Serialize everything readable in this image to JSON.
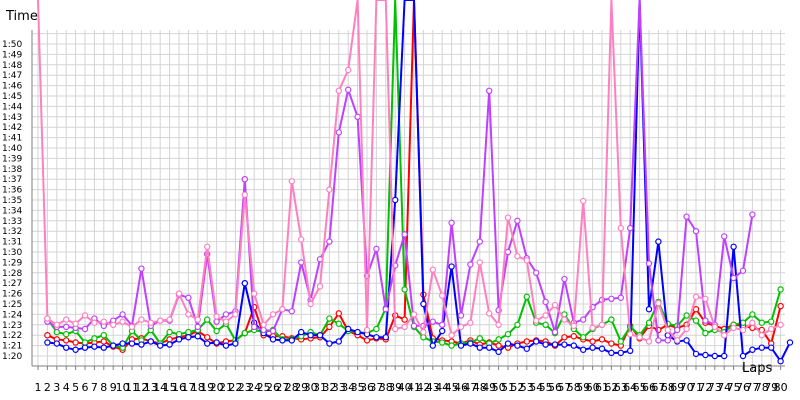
{
  "chart_data": {
    "type": "line",
    "title": "",
    "xlabel": "Laps",
    "ylabel": "Time",
    "xlim": [
      1,
      80
    ],
    "ylim": [
      "1:19",
      "1:51"
    ],
    "grid": true,
    "legend": "none",
    "y_ticks": [
      "1:20",
      "1:21",
      "1:22",
      "1:23",
      "1:24",
      "1:25",
      "1:26",
      "1:27",
      "1:28",
      "1:29",
      "1:30",
      "1:31",
      "1:32",
      "1:33",
      "1:34",
      "1:35",
      "1:36",
      "1:37",
      "1:38",
      "1:39",
      "1:40",
      "1:41",
      "1:42",
      "1:43",
      "1:44",
      "1:45",
      "1:46",
      "1:47",
      "1:48",
      "1:49",
      "1:50"
    ],
    "x_ticks": [
      1,
      2,
      3,
      4,
      5,
      6,
      7,
      8,
      9,
      10,
      11,
      12,
      13,
      14,
      15,
      16,
      17,
      18,
      19,
      20,
      21,
      22,
      23,
      24,
      25,
      26,
      27,
      28,
      29,
      30,
      31,
      32,
      33,
      34,
      35,
      36,
      37,
      38,
      39,
      40,
      41,
      42,
      43,
      44,
      45,
      46,
      47,
      48,
      49,
      50,
      51,
      52,
      53,
      54,
      55,
      56,
      57,
      58,
      59,
      60,
      61,
      62,
      63,
      64,
      65,
      66,
      67,
      68,
      69,
      70,
      71,
      72,
      73,
      74,
      75,
      76,
      77,
      78,
      79,
      80
    ],
    "series": [
      {
        "color": "#ff0000",
        "values": [
          null,
          "1:22.0",
          "1:21.6",
          "1:21.5",
          "1:21.3",
          "1:21.2",
          "1:21.3",
          "1:21.4",
          "1:20.9",
          "1:20.6",
          "1:21.6",
          "1:21.7",
          "1:21.4",
          "1:21.2",
          "1:21.6",
          "1:21.8",
          "1:22.0",
          "1:22.4",
          "1:21.8",
          "1:21.2",
          "1:21.4",
          "1:21.5",
          "1:22.2",
          "1:24.7",
          "1:22.0",
          "1:21.9",
          "1:21.9",
          "1:21.7",
          "1:21.6",
          "1:21.7",
          "1:21.8",
          "1:22.8",
          "1:24.1",
          "1:22.4",
          "1:22.0",
          "1:21.5",
          "1:21.7",
          "1:21.6",
          "1:23.9",
          "1:23.5",
          "2:30.0",
          "1:25.9",
          "1:21.7",
          "1:21.5",
          "1:21.4",
          "1:21.2",
          "1:21.5",
          "1:21.1",
          "1:21.3",
          "1:21.0",
          "1:20.8",
          "1:21.2",
          "1:21.4",
          "1:21.5",
          "1:21.4",
          "1:21.0",
          "1:21.8",
          "1:21.9",
          "1:21.6",
          "1:21.4",
          "1:21.6",
          "1:21.2",
          "1:21.0",
          "1:22.9",
          "1:21.7",
          "1:22.9",
          "1:22.5",
          "1:23.0",
          "1:22.7",
          "1:23.0",
          "1:24.5",
          "1:23.2",
          "1:22.9",
          "1:22.6",
          "1:23.0",
          "1:22.9",
          "1:22.7",
          "1:22.5",
          "1:21.2",
          "1:24.8"
        ]
      },
      {
        "color": "#00c000",
        "values": [
          null,
          "1:23.6",
          "1:22.3",
          "1:22.1",
          "1:22.4",
          "1:21.3",
          "1:21.7",
          "1:22.0",
          "1:21.0",
          "1:20.8",
          "1:22.4",
          "1:21.5",
          "1:22.5",
          "1:21.2",
          "1:22.3",
          "1:22.1",
          "1:22.3",
          "1:22.5",
          "1:23.5",
          "1:22.4",
          "1:23.1",
          "1:21.5",
          "1:22.2",
          "1:22.5",
          "1:22.3",
          "1:22.5",
          "1:21.6",
          "1:21.6",
          "1:21.9",
          "1:22.3",
          "1:22.0",
          "1:23.6",
          "1:23.1",
          "1:22.4",
          "1:22.3",
          "1:22.2",
          "1:22.6",
          "1:24.6",
          "2:30.0",
          "1:26.4",
          "1:22.8",
          "1:21.8",
          "1:21.4",
          "1:21.3",
          "1:21.0",
          "1:21.2",
          "1:21.3",
          "1:21.7",
          "1:21.2",
          "1:21.6",
          "1:22.1",
          "1:23.0",
          "1:25.7",
          "1:23.2",
          "1:23.0",
          "1:22.2",
          "1:24.0",
          "1:22.6",
          "1:21.8",
          "1:22.6",
          "1:23.0",
          "1:23.5",
          "1:21.4",
          "1:22.8",
          "1:22.0",
          "1:23.2",
          "1:25.2",
          "1:23.1",
          "1:22.9",
          "1:23.9",
          "1:23.4",
          "1:22.2",
          "1:22.5",
          "1:22.3",
          "1:23.0",
          "1:23.2",
          "1:24.0",
          "1:23.2",
          "1:23.3",
          "1:26.4"
        ]
      },
      {
        "color": "#0000ff",
        "values": [
          null,
          "1:21.3",
          "1:21.2",
          "1:20.8",
          "1:20.6",
          "1:20.8",
          "1:20.9",
          "1:20.8",
          "1:21.0",
          "1:21.2",
          "1:21.2",
          "1:21.1",
          "1:21.4",
          "1:21.0",
          "1:21.1",
          "1:21.6",
          "1:21.8",
          "1:21.9",
          "1:21.2",
          "1:21.3",
          "1:21.0",
          "1:21.2",
          "1:27.0",
          "1:23.2",
          "1:22.2",
          "1:21.6",
          "1:21.5",
          "1:21.5",
          "1:22.3",
          "1:22.0",
          "1:22.0",
          "1:21.2",
          "1:21.4",
          "1:22.6",
          "1:22.3",
          "1:22.1",
          "1:21.8",
          "1:21.8",
          "1:35.0",
          "2:30.0",
          "2:30.0",
          "1:25.0",
          "1:21.0",
          "1:22.4",
          "1:28.6",
          "1:21.0",
          "1:21.2",
          "1:20.8",
          "1:20.8",
          "1:20.4",
          "1:21.2",
          "1:21.0",
          "1:20.7",
          "1:21.4",
          "1:21.1",
          "1:21.1",
          "1:21.1",
          "1:21.0",
          "1:20.6",
          "1:20.8",
          "1:20.7",
          "1:20.3",
          "1:20.3",
          "1:20.5",
          "2:30.0",
          "1:24.5",
          "1:31.0",
          "1:22.0",
          "1:21.4",
          "1:21.5",
          "1:20.2",
          "1:20.1",
          "1:20.0",
          "1:20.0",
          "1:30.5",
          "1:20.0",
          "1:20.6",
          "1:20.8",
          "1:20.8",
          "1:19.5",
          "1:21.3"
        ]
      },
      {
        "color": "#c040ff",
        "values": [
          null,
          "1:23.3",
          "1:22.8",
          "1:22.8",
          "1:22.7",
          "1:22.6",
          "1:23.6",
          "1:22.9",
          "1:23.4",
          "1:24.0",
          "1:22.9",
          "1:28.4",
          "1:22.9",
          "1:23.4",
          "1:23.4",
          "1:25.9",
          "1:25.6",
          "1:22.8",
          "1:29.8",
          "1:23.3",
          "1:24.0",
          "1:24.3",
          "1:37.0",
          "1:22.8",
          "1:22.5",
          "1:22.4",
          "1:24.5",
          "1:24.3",
          "1:29.0",
          "1:25.4",
          "1:29.3",
          "1:31.0",
          "1:41.5",
          "1:45.6",
          "1:43.0",
          "1:27.7",
          "1:30.3",
          "1:24.5",
          "1:28.7",
          "1:31.7",
          "1:22.9",
          "1:22.9",
          "1:23.3",
          "1:23.0",
          "1:32.8",
          "1:23.9",
          "1:28.8",
          "1:31.0",
          "1:45.5",
          "1:24.4",
          "1:30.0",
          "1:33.0",
          "1:29.4",
          "1:28.0",
          "1:25.2",
          "1:22.3",
          "1:27.4",
          "1:23.2",
          "1:23.5",
          "1:24.7",
          "1:25.4",
          "1:25.5",
          "1:25.6",
          "1:32.3",
          "2:30.0",
          "1:28.9",
          "1:21.5",
          "1:21.5",
          "1:22.5",
          "1:33.4",
          "1:32.0",
          "1:23.4",
          "1:23.0",
          "1:31.5",
          "1:27.5",
          "1:28.2",
          "1:33.6",
          null,
          null,
          null
        ]
      },
      {
        "color": "#ff80c0",
        "values": [
          "2:30.0",
          "1:23.6",
          "1:23.0",
          "1:23.5",
          "1:23.1",
          "1:23.9",
          "1:23.2",
          "1:23.3",
          "1:23.0",
          "1:23.3",
          "1:22.8",
          "1:23.5",
          "1:23.2",
          "1:23.4",
          "1:23.5",
          "1:26.0",
          "1:24.0",
          "1:23.5",
          "1:30.5",
          "1:23.8",
          "1:23.3",
          "1:24.0",
          "1:35.5",
          "1:26.0",
          "1:23.0",
          "1:24.0",
          "1:24.5",
          "1:36.8",
          "1:31.2",
          "1:25.0",
          "1:26.7",
          "1:36.0",
          "1:45.5",
          "1:47.5",
          "2:30.0",
          "1:22.5",
          "2:30.0",
          "2:30.0",
          "1:22.6",
          "1:22.8",
          "1:24.0",
          "1:22.3",
          "1:28.3",
          "1:25.8",
          "1:22.0",
          "1:22.8",
          "1:23.2",
          "1:29.0",
          "1:24.1",
          "1:23.0",
          "1:33.3",
          "1:29.6",
          "1:29.2",
          "1:23.4",
          "1:23.9",
          "1:24.9",
          "1:23.5",
          "1:22.9",
          "1:34.9",
          "1:22.7",
          "1:23.0",
          "2:30.0",
          "1:32.3",
          "1:22.1",
          "1:21.8",
          "1:21.4",
          "1:25.1",
          "1:22.5",
          "1:21.5",
          "1:22.6",
          "1:25.7",
          "1:25.5",
          "1:22.8",
          "1:22.0",
          "1:22.7",
          "1:22.5",
          "1:23.2",
          "1:22.0",
          "1:22.6",
          "1:23.0"
        ]
      }
    ]
  }
}
